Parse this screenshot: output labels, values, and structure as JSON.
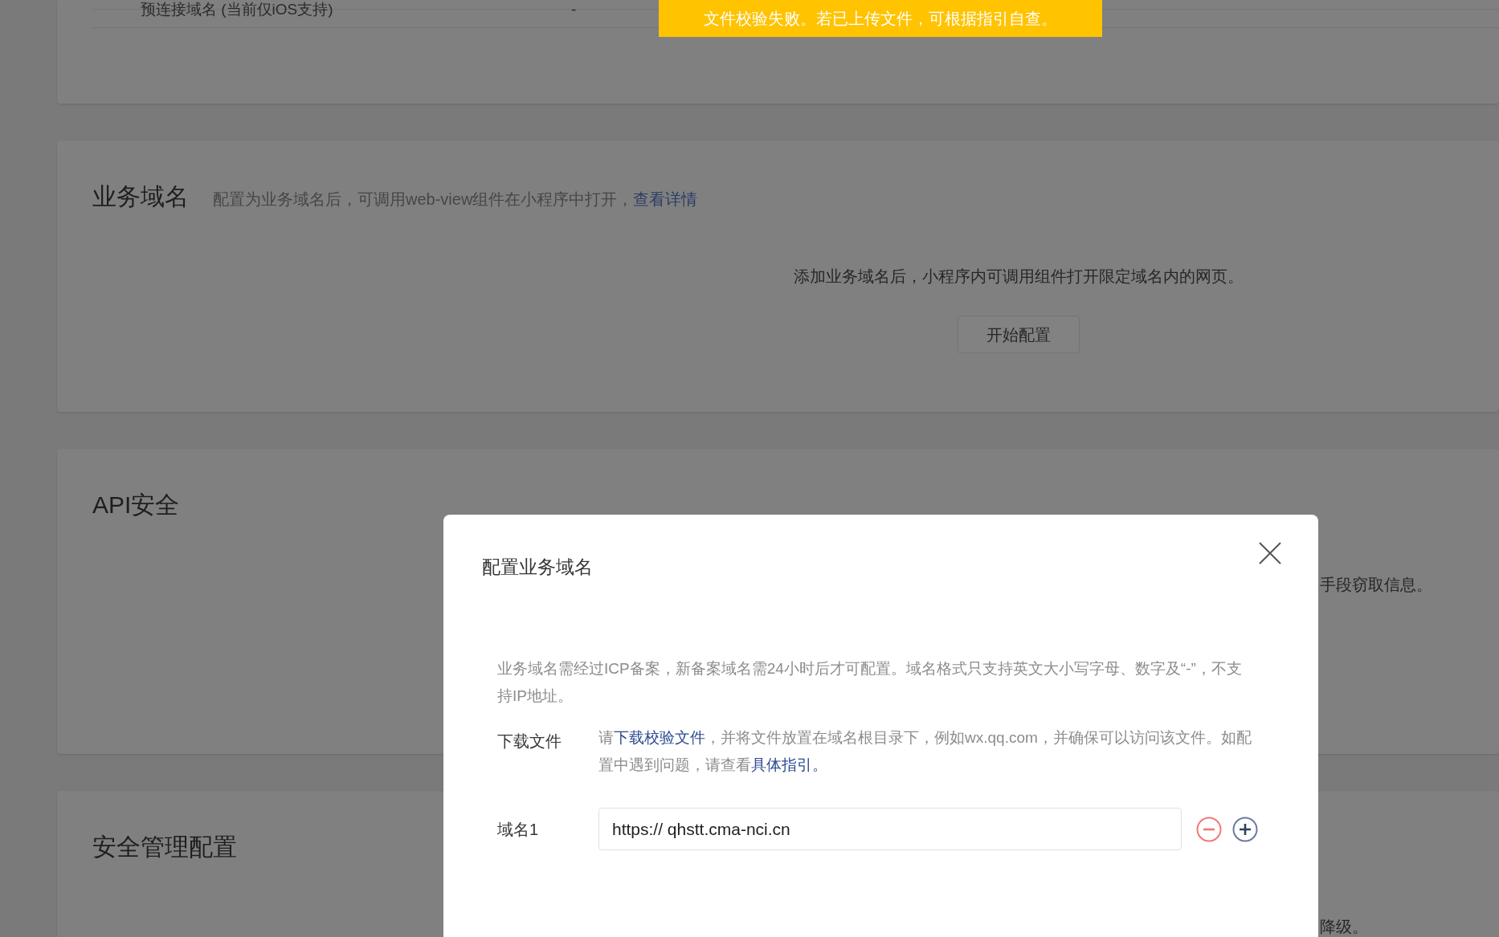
{
  "toast": {
    "text": "文件校验失败。若已上传文件，可根据指引自查。"
  },
  "sections": [
    {
      "kind": "row",
      "label": "预连接域名 (当前仅iOS支持)",
      "value": "-"
    },
    {
      "kind": "domain",
      "title": "业务域名",
      "description": "配置为业务域名后，可调用web-view组件在小程序中打开，",
      "link": "查看详情",
      "empty_text": "添加业务域名后，小程序内可调用组件打开限定域名内的网页。",
      "button": "开始配置"
    },
    {
      "kind": "partial",
      "title": "API安全",
      "fragment": "手段窃取信息。"
    },
    {
      "kind": "partial",
      "title": "安全管理配置",
      "fragment": "降级。"
    }
  ],
  "dialog": {
    "title": "配置业务域名",
    "notice": "业务域名需经过ICP备案，新备案域名需24小时后才可配置。域名格式只支持英文大小写字母、数字及“-”，不支持IP地址。",
    "download": {
      "label": "下载文件",
      "segments": [
        {
          "text": "请"
        },
        {
          "text": "下载校验文件",
          "link": true
        },
        {
          "text": "，并将文件放置在域名根目录下，例如wx.qq.com，并确保可以访问该文件。如配置中遇到问题，请查看"
        },
        {
          "text": "具体指引。",
          "link": true
        }
      ]
    },
    "domains": [
      {
        "label": "域名1",
        "value": "https:// qhstt.cma-nci.cn"
      }
    ]
  }
}
